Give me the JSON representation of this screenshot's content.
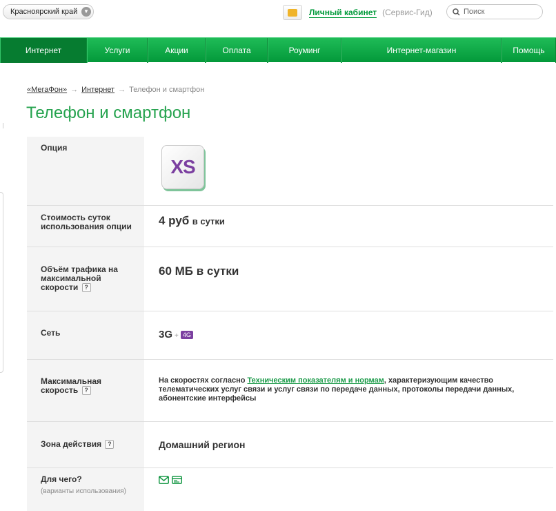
{
  "header": {
    "region": "Красноярский край",
    "cabinet_link": "Личный кабинет",
    "cabinet_guide": "(Сервис-Гид)",
    "search_placeholder": "Поиск"
  },
  "nav": [
    "Интернет",
    "Услуги",
    "Акции",
    "Оплата",
    "Роуминг",
    "Интернет-магазин",
    "Помощь"
  ],
  "breadcrumb": {
    "items": [
      "«МегаФон»",
      "Интернет"
    ],
    "current": "Телефон и смартфон",
    "separator": "→"
  },
  "page_title": "Телефон и смартфон",
  "table": {
    "option": {
      "label": "Опция",
      "tile_text": "XS"
    },
    "cost": {
      "label": "Стоимость суток использования опции",
      "value": "4 руб",
      "unit": "в сутки"
    },
    "traffic": {
      "label": "Объём трафика на максимальной скорости",
      "value": "60 МБ в сутки"
    },
    "network": {
      "label": "Сеть",
      "value": "3G",
      "plus": "+",
      "badge": "4G"
    },
    "speed": {
      "label": "Максимальная скорость",
      "text_before": "На скоростях согласно ",
      "link": "Техническим показателям и нормам",
      "text_after": ", характеризующим качество телематических услуг связи и услуг связи по передаче данных, протоколы передачи данных, абонентские интерфейсы"
    },
    "zone": {
      "label": "Зона действия",
      "value": "Домашний регион"
    },
    "usage": {
      "label": "Для чего?",
      "sublabel": "(варианты использования)"
    }
  },
  "help_mark": "?",
  "colors": {
    "brand_green": "#03993a",
    "title_green": "#26a34f",
    "purple": "#7b3fa0"
  }
}
